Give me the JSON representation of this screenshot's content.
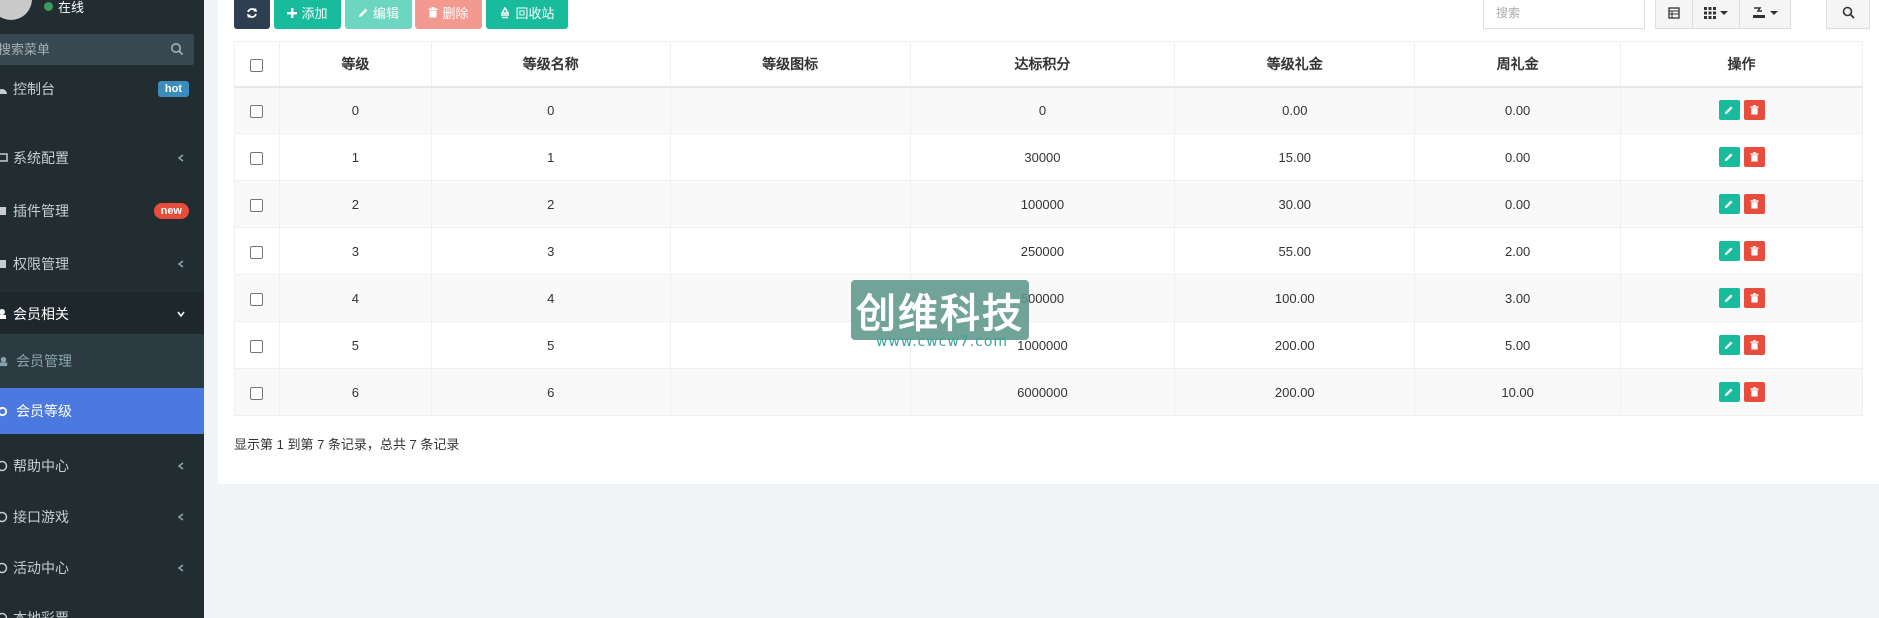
{
  "sidebar": {
    "status": "在线",
    "search_placeholder": "搜索菜单",
    "items": [
      {
        "label": "控制台",
        "badge": "hot"
      },
      {
        "label": "系统配置"
      },
      {
        "label": "插件管理",
        "badge": "new"
      },
      {
        "label": "权限管理"
      },
      {
        "label": "会员相关"
      },
      {
        "label": "会员管理"
      },
      {
        "label": "会员等级"
      },
      {
        "label": "帮助中心"
      },
      {
        "label": "接口游戏"
      },
      {
        "label": "活动中心"
      },
      {
        "label": "本地彩票"
      }
    ]
  },
  "toolbar": {
    "add_label": "添加",
    "edit_label": "编辑",
    "delete_label": "删除",
    "recycle_label": "回收站",
    "search_placeholder": "搜索"
  },
  "table": {
    "headers": [
      "等级",
      "等级名称",
      "等级图标",
      "达标积分",
      "等级礼金",
      "周礼金",
      "操作"
    ],
    "rows": [
      [
        "0",
        "0",
        "",
        "0",
        "0.00",
        "0.00"
      ],
      [
        "1",
        "1",
        "",
        "30000",
        "15.00",
        "0.00"
      ],
      [
        "2",
        "2",
        "",
        "100000",
        "30.00",
        "0.00"
      ],
      [
        "3",
        "3",
        "",
        "250000",
        "55.00",
        "2.00"
      ],
      [
        "4",
        "4",
        "",
        "500000",
        "100.00",
        "3.00"
      ],
      [
        "5",
        "5",
        "",
        "1000000",
        "200.00",
        "5.00"
      ],
      [
        "6",
        "6",
        "",
        "6000000",
        "200.00",
        "10.00"
      ]
    ]
  },
  "pagination_text": "显示第 1 到第 7 条记录，总共 7 条记录",
  "watermark": {
    "text": "创维科技",
    "url": "www.cwcw7.com"
  },
  "colors": {
    "sidebar_bg": "#222d32",
    "active": "#4c79df",
    "success": "#18bc9c",
    "danger": "#e74c3c"
  }
}
